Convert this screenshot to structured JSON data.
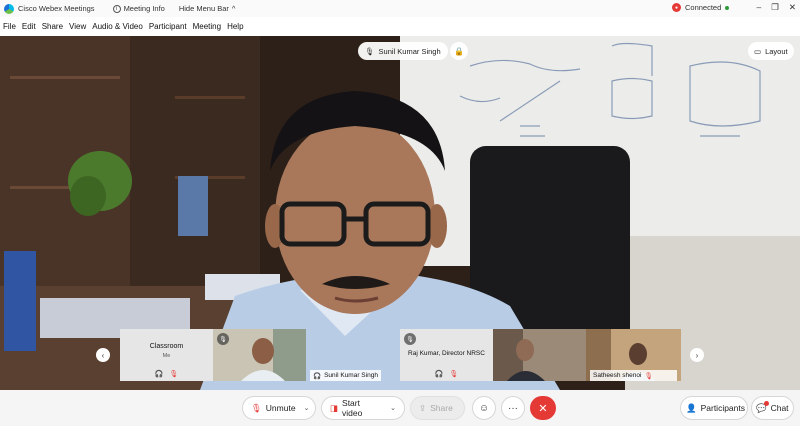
{
  "titlebar": {
    "app_name": "Cisco Webex Meetings",
    "meeting_info": "Meeting Info",
    "hide_menu": "Hide Menu Bar",
    "hide_menu_chevron": "^",
    "connection": "Connected",
    "window_minimize": "–",
    "window_restore": "❐",
    "window_close": "✕"
  },
  "menu": [
    "File",
    "Edit",
    "Share",
    "View",
    "Audio & Video",
    "Participant",
    "Meeting",
    "Help"
  ],
  "stage": {
    "active_speaker": "Sunil Kumar Singh",
    "layout_label": "Layout"
  },
  "filmstrip": {
    "prev_arrow": "‹",
    "next_arrow": "›",
    "tiles": [
      {
        "name": "Classroom",
        "subtitle": "Me"
      },
      {
        "name": "Sunil Kumar Singh"
      },
      {
        "name": "Raj Kumar, Director NRSC"
      },
      {
        "name": ""
      },
      {
        "name": "Satheesh shenoi"
      }
    ]
  },
  "toolbar": {
    "unmute": "Unmute",
    "start_video": "Start video",
    "share": "Share",
    "more": "···",
    "end": "✕",
    "participants": "Participants",
    "chat": "Chat"
  },
  "colors": {
    "accent_red": "#e53935",
    "connected_green": "#2e9b3a",
    "toolbar_bg": "#f5f5f5"
  }
}
